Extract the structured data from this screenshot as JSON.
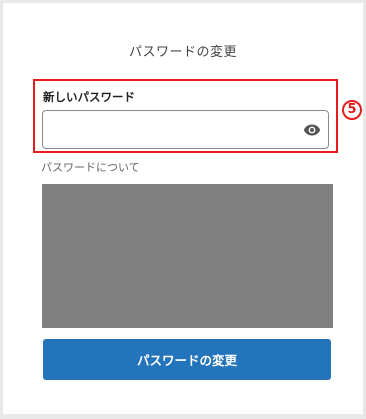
{
  "page": {
    "title": "パスワードの変更"
  },
  "new_password": {
    "label": "新しいパスワード",
    "value": "",
    "placeholder": "",
    "toggle_icon": "eye-icon"
  },
  "annotation": {
    "step_number": "5",
    "highlight_color": "#e31c1c"
  },
  "password_info": {
    "label": "パスワードについて"
  },
  "submit": {
    "label": "パスワードの変更",
    "color": "#2474bb"
  }
}
